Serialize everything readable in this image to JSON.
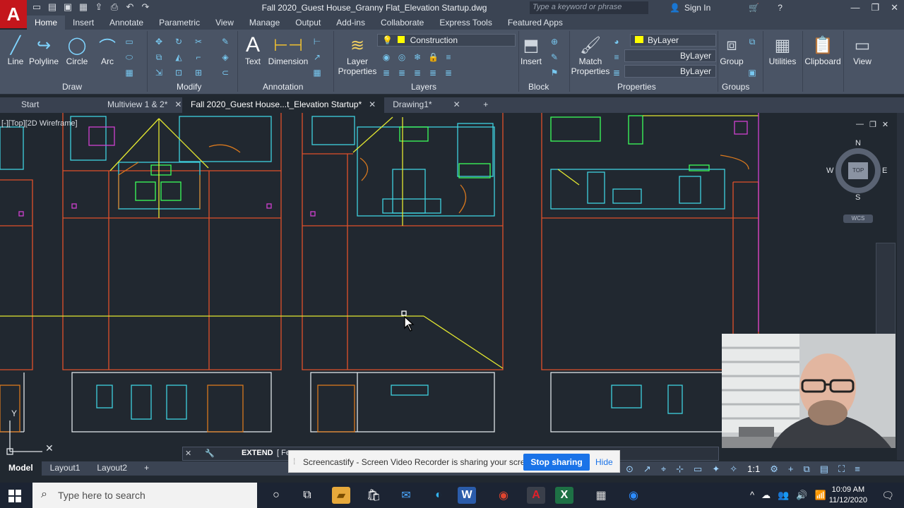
{
  "app": {
    "logo_letter": "A",
    "title": "Fall 2020_Guest House_Granny Flat_Elevation Startup.dwg",
    "search_placeholder": "Type a keyword or phrase",
    "signin": "Sign In"
  },
  "ribbon_tabs": [
    "Home",
    "Insert",
    "Annotate",
    "Parametric",
    "View",
    "Manage",
    "Output",
    "Add-ins",
    "Collaborate",
    "Express Tools",
    "Featured Apps"
  ],
  "draw": {
    "title": "Draw",
    "line": "Line",
    "polyline": "Polyline",
    "circle": "Circle",
    "arc": "Arc"
  },
  "modify": {
    "title": "Modify"
  },
  "annotation": {
    "title": "Annotation",
    "text": "Text",
    "dimension": "Dimension"
  },
  "layers": {
    "title": "Layers",
    "layer_props_1": "Layer",
    "layer_props_2": "Properties",
    "current_layer": "Construction"
  },
  "block": {
    "title": "Block",
    "insert": "Insert"
  },
  "properties": {
    "title": "Properties",
    "match_1": "Match",
    "match_2": "Properties",
    "color": "ByLayer",
    "linetype": "ByLayer",
    "lineweight": "ByLayer"
  },
  "groups": {
    "title": "Groups",
    "group": "Group"
  },
  "utilities": {
    "label": "Utilities"
  },
  "clipboard": {
    "label": "Clipboard"
  },
  "view": {
    "label": "View"
  },
  "doc_tabs": [
    {
      "label": "Start"
    },
    {
      "label": "Multiview 1 & 2*"
    },
    {
      "label": "Fall 2020_Guest House...t_Elevation Startup*"
    },
    {
      "label": "Drawing1*"
    }
  ],
  "viewport_label": "[-][Top][2D Wireframe]",
  "viewcube": {
    "n": "N",
    "s": "S",
    "e": "E",
    "w": "W",
    "top": "TOP",
    "wcs": "WCS"
  },
  "command": {
    "prompt": "EXTEND",
    "option": "[ Fe"
  },
  "layout_tabs": [
    "Model",
    "Layout1",
    "Layout2"
  ],
  "status": {
    "scale": "1:1"
  },
  "screencastify": {
    "message": "Screencastify - Screen Video Recorder is sharing your screen.",
    "stop": "Stop sharing",
    "hide": "Hide"
  },
  "taskbar": {
    "search_placeholder": "Type here to search",
    "time": "10:09 AM",
    "date": "11/12/2020"
  },
  "colors": {
    "cad_bg": "#212830",
    "wall_red": "#e0502a",
    "cyan": "#3fd2e0",
    "green": "#3cff5a",
    "yellow": "#e4e830",
    "magenta": "#d040d0",
    "orange": "#d8781e"
  }
}
